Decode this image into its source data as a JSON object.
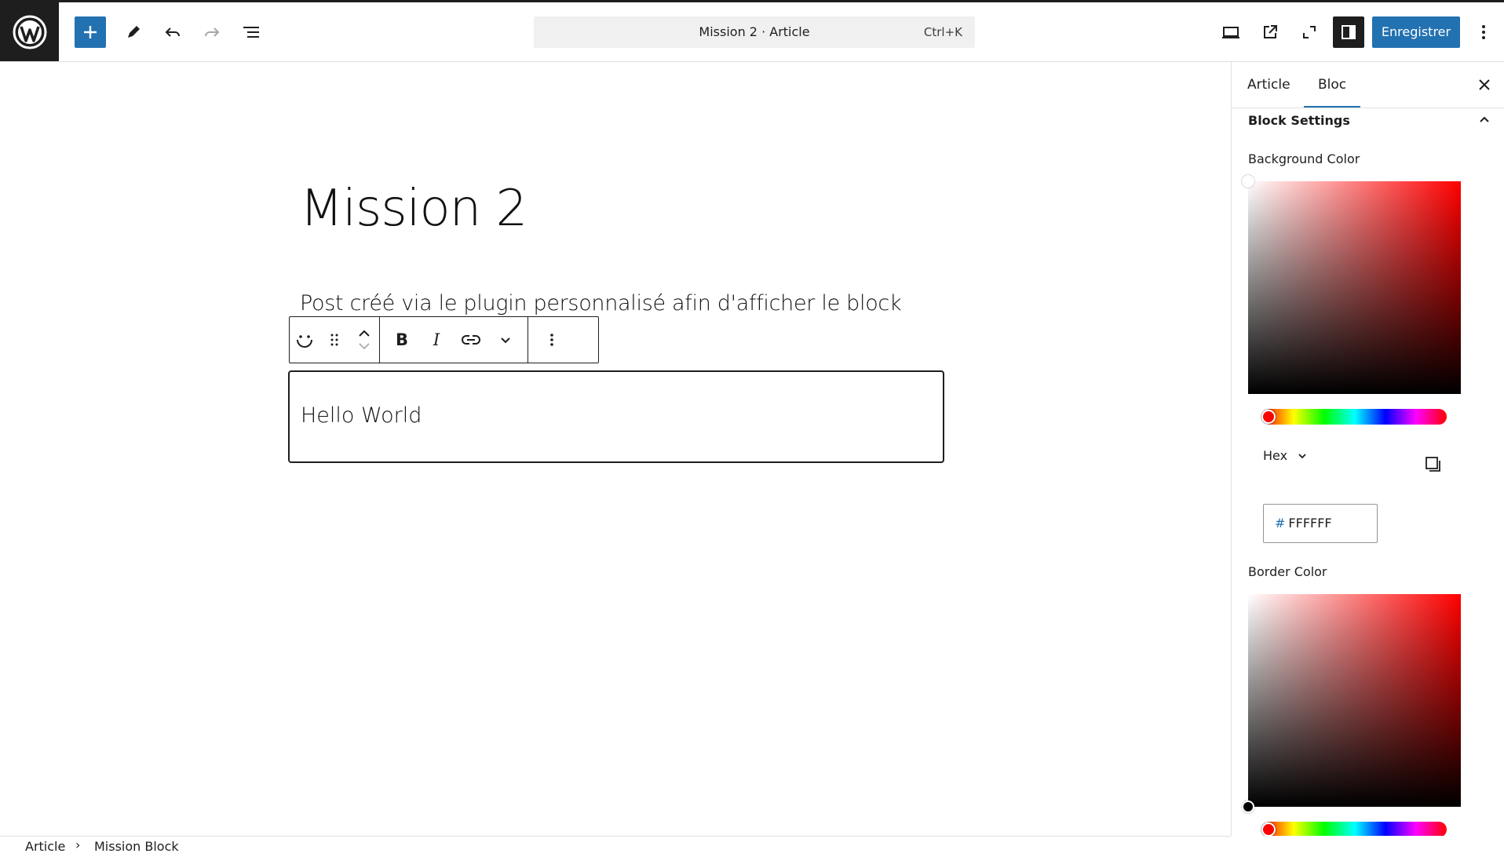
{
  "header": {
    "add_block_label": "+",
    "command_bar": {
      "title": "Mission 2 · Article",
      "shortcut": "Ctrl+K"
    },
    "save_label": "Enregistrer",
    "icons": [
      "wordpress-logo-icon",
      "add-icon",
      "pencil-icon",
      "undo-icon",
      "redo-icon",
      "list-view-icon",
      "desktop-preview-icon",
      "external-view-icon",
      "fullscreen-icon",
      "sidebar-settings-icon",
      "more-vertical-icon"
    ]
  },
  "editor": {
    "title": "Mission 2",
    "paragraph": "Post créé via le plugin personnalisé afin d'afficher le block",
    "block_text": "Hello World",
    "toolbar": {
      "bold_label": "B",
      "italic_label": "I",
      "icons": [
        "block-type-smiley-icon",
        "drag-handle-icon",
        "move-up-icon",
        "move-down-icon",
        "bold-icon",
        "italic-icon",
        "link-icon",
        "chevron-down-icon",
        "more-options-icon"
      ]
    }
  },
  "sidebar": {
    "tabs": [
      {
        "label": "Article"
      },
      {
        "label": "Bloc",
        "active": true
      }
    ],
    "panel_title": "Block Settings",
    "background_color": {
      "label": "Background Color",
      "format_label": "Hex",
      "hash": "#",
      "hex_value": "FFFFFF",
      "hue_color": "#ff0000"
    },
    "border_color": {
      "label": "Border Color",
      "hue_color": "#ff0000"
    }
  },
  "footer": {
    "breadcrumb": [
      "Article",
      "Mission Block"
    ]
  },
  "colors": {
    "accent": "#2271b1",
    "dark": "#1e1e1e"
  }
}
